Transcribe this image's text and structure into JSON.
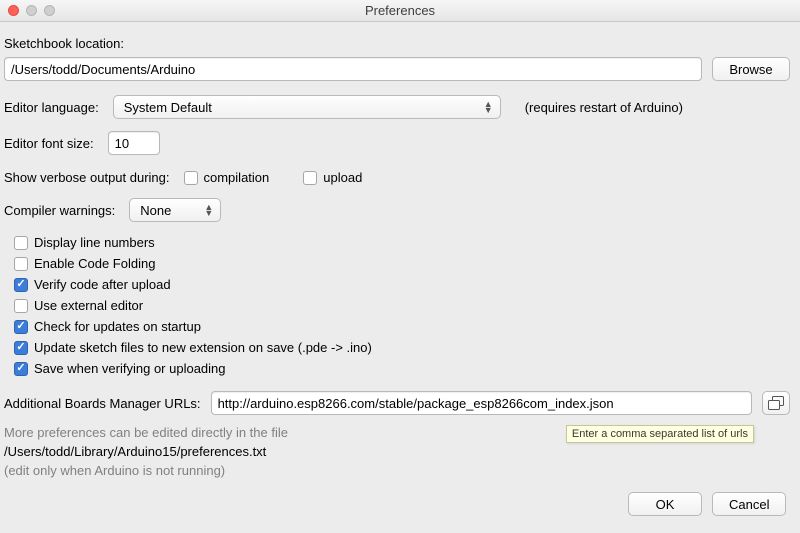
{
  "window": {
    "title": "Preferences"
  },
  "sketchbook": {
    "label": "Sketchbook location:",
    "path": "/Users/todd/Documents/Arduino",
    "browse": "Browse"
  },
  "editor_language": {
    "label": "Editor language:",
    "value": "System Default",
    "note": "(requires restart of Arduino)"
  },
  "editor_font": {
    "label": "Editor font size:",
    "value": "10"
  },
  "verbose": {
    "label": "Show verbose output during:",
    "compilation_label": "compilation",
    "compilation_checked": false,
    "upload_label": "upload",
    "upload_checked": false
  },
  "compiler_warnings": {
    "label": "Compiler warnings:",
    "value": "None"
  },
  "checks": {
    "display_line_numbers": {
      "label": "Display line numbers",
      "checked": false
    },
    "enable_code_folding": {
      "label": "Enable Code Folding",
      "checked": false
    },
    "verify_after_upload": {
      "label": "Verify code after upload",
      "checked": true
    },
    "use_external_editor": {
      "label": "Use external editor",
      "checked": false
    },
    "check_updates_startup": {
      "label": "Check for updates on startup",
      "checked": true
    },
    "update_sketch_ext": {
      "label": "Update sketch files to new extension on save (.pde -> .ino)",
      "checked": true
    },
    "save_when_verifying": {
      "label": "Save when verifying or uploading",
      "checked": true
    }
  },
  "boards": {
    "label": "Additional Boards Manager URLs:",
    "value": "http://arduino.esp8266.com/stable/package_esp8266com_index.json",
    "tooltip": "Enter a comma separated list of urls"
  },
  "more": {
    "line1": "More preferences can be edited directly in the file",
    "line2": "/Users/todd/Library/Arduino15/preferences.txt",
    "line3": "(edit only when Arduino is not running)"
  },
  "buttons": {
    "ok": "OK",
    "cancel": "Cancel"
  }
}
